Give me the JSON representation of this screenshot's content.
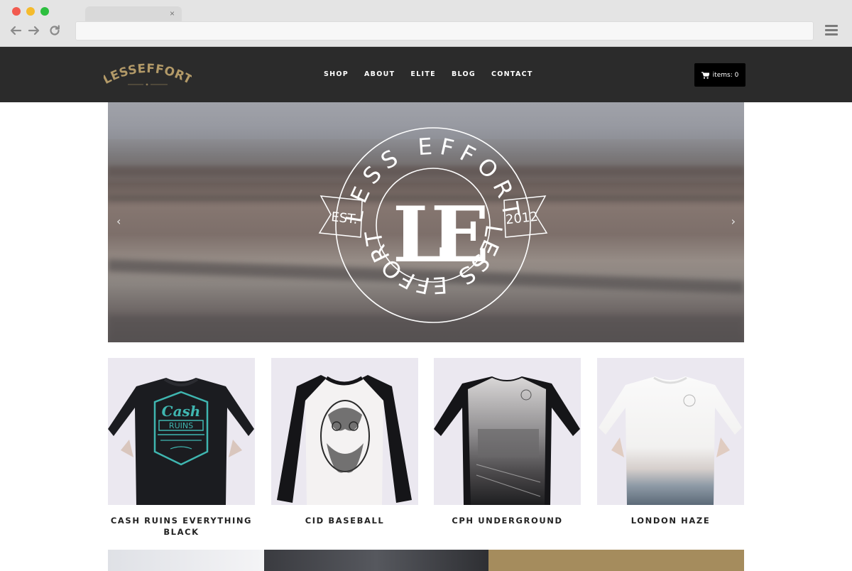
{
  "browser": {
    "tab_close": "×"
  },
  "site": {
    "logo_text": "LESSEFFORT",
    "nav": [
      "SHOP",
      "ABOUT",
      "ELITE",
      "BLOG",
      "CONTACT"
    ],
    "cart_label": "items: 0"
  },
  "hero": {
    "emblem_top_text": "LESS EFFORT",
    "emblem_bottom_text": "LESS EFFORT",
    "emblem_monogram": "LE",
    "ribbon_left": "EST.",
    "ribbon_right": "2012",
    "prev_arrow": "‹",
    "next_arrow": "›"
  },
  "products": [
    {
      "title": "CASH RUINS EVERYTHING BLACK",
      "print": "Cash RUINS"
    },
    {
      "title": "CID BASEBALL"
    },
    {
      "title": "CPH UNDERGROUND"
    },
    {
      "title": "LONDON HAZE"
    }
  ],
  "colors": {
    "header_bg": "#2b2b2b",
    "logo_gold": "#b39a68",
    "cart_bg": "#000000",
    "accent_gold": "#a58c5d"
  }
}
